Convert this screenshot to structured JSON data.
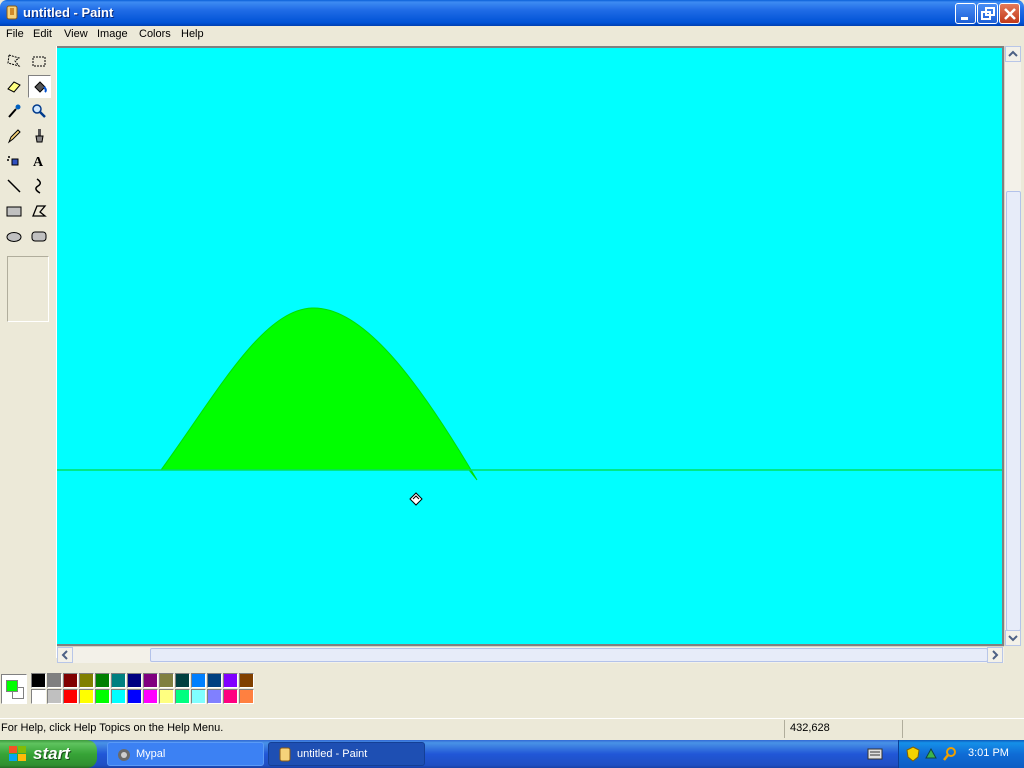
{
  "window": {
    "title": "untitled - Paint"
  },
  "menu": {
    "items": [
      "File",
      "Edit",
      "View",
      "Image",
      "Colors",
      "Help"
    ]
  },
  "toolbox": {
    "tools": [
      {
        "name": "free-form-select",
        "icon": "free-select-icon"
      },
      {
        "name": "select",
        "icon": "rect-select-icon"
      },
      {
        "name": "eraser",
        "icon": "eraser-icon"
      },
      {
        "name": "fill-with-color",
        "icon": "paint-bucket-icon",
        "active": true
      },
      {
        "name": "pick-color",
        "icon": "eyedropper-icon"
      },
      {
        "name": "magnifier",
        "icon": "magnifier-icon"
      },
      {
        "name": "pencil",
        "icon": "pencil-icon"
      },
      {
        "name": "brush",
        "icon": "brush-icon"
      },
      {
        "name": "airbrush",
        "icon": "airbrush-icon"
      },
      {
        "name": "text",
        "icon": "text-icon"
      },
      {
        "name": "line",
        "icon": "line-icon"
      },
      {
        "name": "curve",
        "icon": "curve-icon"
      },
      {
        "name": "rectangle",
        "icon": "rectangle-icon"
      },
      {
        "name": "polygon",
        "icon": "polygon-icon"
      },
      {
        "name": "ellipse",
        "icon": "ellipse-icon"
      },
      {
        "name": "rounded-rectangle",
        "icon": "rounded-rect-icon"
      }
    ]
  },
  "canvas": {
    "background_color": "#00ffff",
    "shape_color": "#00ff00"
  },
  "palette": {
    "foreground": "#00ff00",
    "background": "#ffffff",
    "row1": [
      "#000000",
      "#808080",
      "#800000",
      "#808000",
      "#008000",
      "#008080",
      "#000080",
      "#800080",
      "#808040",
      "#004040",
      "#0080ff",
      "#004080",
      "#8000ff",
      "#804000"
    ],
    "row2": [
      "#ffffff",
      "#c0c0c0",
      "#ff0000",
      "#ffff00",
      "#00ff00",
      "#00ffff",
      "#0000ff",
      "#ff00ff",
      "#ffff80",
      "#00ff80",
      "#80ffff",
      "#8080ff",
      "#ff0080",
      "#ff8040"
    ]
  },
  "status": {
    "help_text": "For Help, click Help Topics on the Help Menu.",
    "coordinates": "432,628"
  },
  "taskbar": {
    "start_label": "start",
    "tasks": [
      {
        "label": "Mypal",
        "active": false
      },
      {
        "label": "untitled - Paint",
        "active": true
      }
    ],
    "clock": "3:01 PM"
  }
}
